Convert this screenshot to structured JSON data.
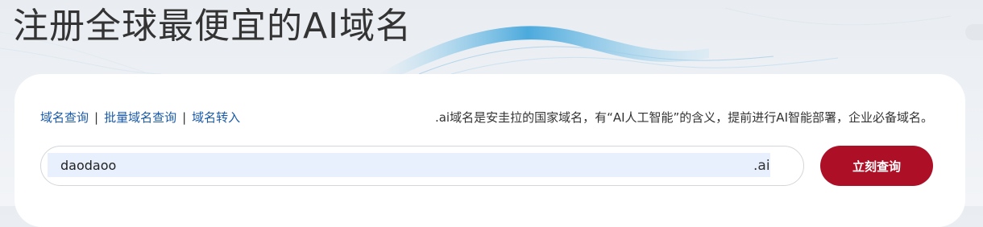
{
  "hero": {
    "title": "注册全球最便宜的AI域名"
  },
  "nav": {
    "links": [
      "域名查询",
      "批量域名查询",
      "域名转入"
    ],
    "separator": "|"
  },
  "description": ".ai域名是安圭拉的国家域名，有“AI人工智能”的含义，提前进行AI智能部署，企业必备域名。",
  "search": {
    "value": "daodaoo",
    "suffix": ".ai",
    "button_label": "立刻查询"
  },
  "colors": {
    "link": "#1a5aa8",
    "button": "#ad0f26",
    "input_fill": "#e8f0fe"
  }
}
